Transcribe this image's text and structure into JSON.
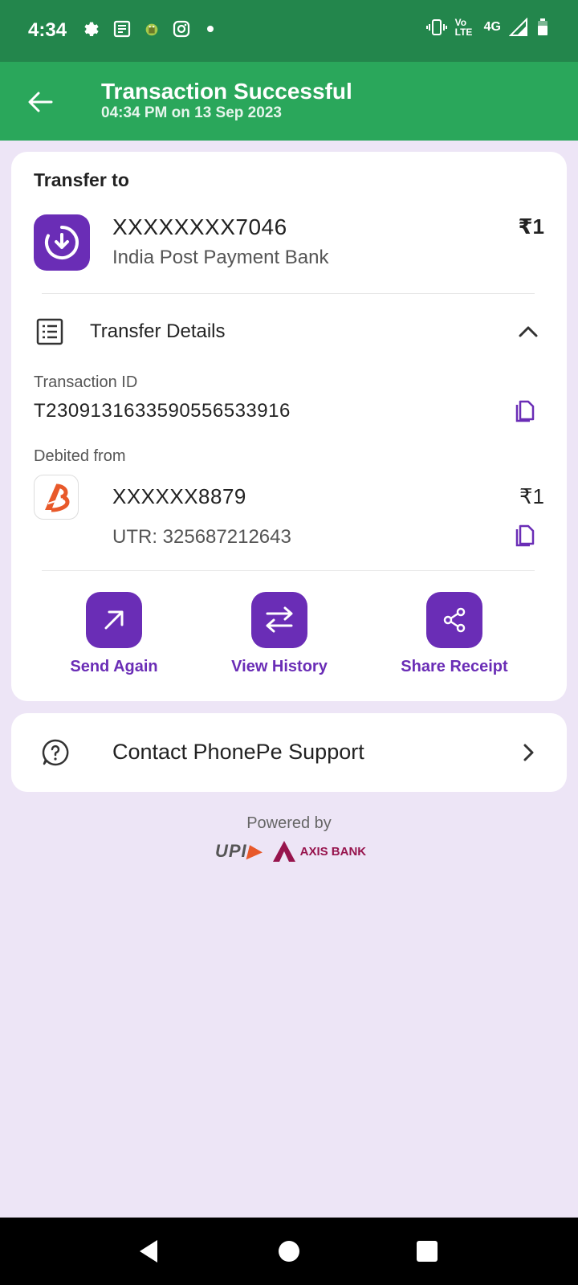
{
  "status_bar": {
    "time": "4:34",
    "network": "4G",
    "volte": "Vo LTE",
    "icons": [
      "gear-icon",
      "news-icon",
      "android-icon",
      "instagram-icon",
      "dot-icon",
      "vibrate-icon",
      "signal-icon",
      "battery-icon"
    ]
  },
  "header": {
    "title": "Transaction Successful",
    "subtitle": "04:34 PM on 13 Sep 2023"
  },
  "transfer": {
    "label": "Transfer to",
    "payee": "XXXXXXXX7046",
    "bank": "India Post Payment Bank",
    "amount": "₹1"
  },
  "details": {
    "section_label": "Transfer Details",
    "txn_id_label": "Transaction ID",
    "txn_id": "T2309131633590556533916",
    "debited_label": "Debited from",
    "account": "XXXXXX8879",
    "account_amount": "₹1",
    "utr": "UTR: 325687212643"
  },
  "actions": [
    {
      "label": "Send Again",
      "icon": "arrow-up-right-icon"
    },
    {
      "label": "View History",
      "icon": "swap-arrows-icon"
    },
    {
      "label": "Share Receipt",
      "icon": "share-icon"
    }
  ],
  "support": {
    "label": "Contact PhonePe Support"
  },
  "footer": {
    "powered_by": "Powered by",
    "upi": "UPI",
    "bank": "AXIS BANK"
  },
  "colors": {
    "status_bar": "#23864c",
    "header": "#2aa75b",
    "accent": "#6a2db6",
    "background": "#ede5f6"
  }
}
